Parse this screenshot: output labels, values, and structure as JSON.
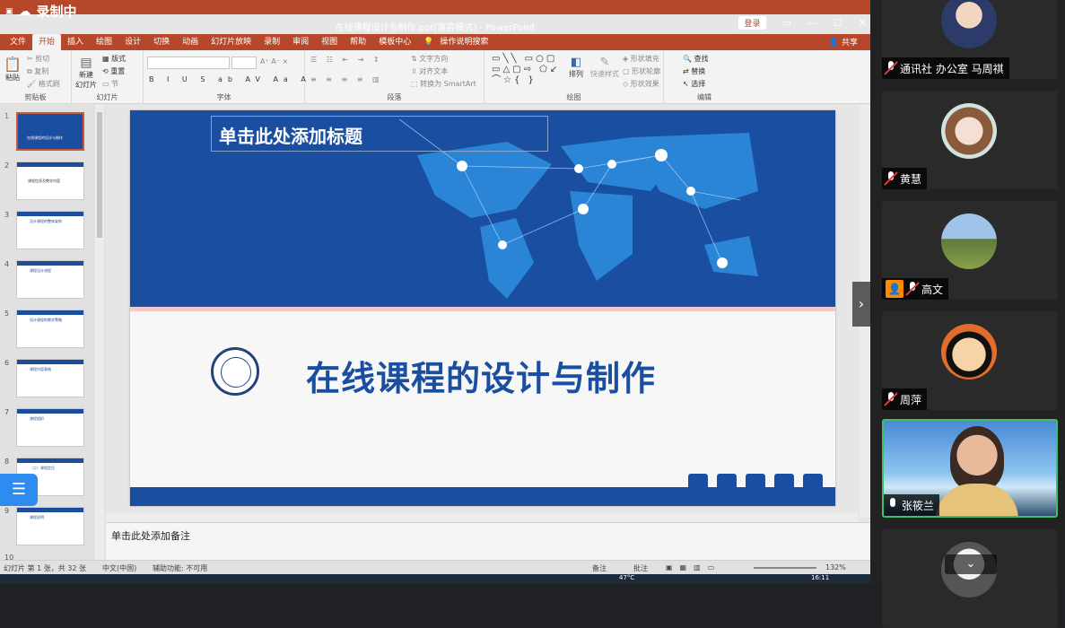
{
  "recording": {
    "label": "录制中"
  },
  "window": {
    "title": "在线课程设计与制作.ppt[兼容模式] - PowerPoint",
    "login_label": "登录",
    "share_label": "共享"
  },
  "tabs": [
    "文件",
    "开始",
    "插入",
    "绘图",
    "设计",
    "切换",
    "动画",
    "幻灯片放映",
    "录制",
    "审阅",
    "视图",
    "帮助",
    "模板中心",
    "操作说明搜索"
  ],
  "ribbon": {
    "clipboard": {
      "paste": "粘贴",
      "cut": "剪切",
      "copy": "复制",
      "format_painter": "格式刷",
      "group": "剪贴板"
    },
    "slides": {
      "new_slide": "新建\n幻灯片",
      "layout": "版式",
      "reset": "重置",
      "section": "节",
      "group": "幻灯片"
    },
    "font": {
      "group": "字体"
    },
    "paragraph": {
      "text_direction": "文字方向",
      "align_text": "对齐文本",
      "smartart": "转换为 SmartArt",
      "group": "段落"
    },
    "drawing": {
      "arrange": "排列",
      "quick_styles": "快速样式",
      "fill": "形状填充",
      "outline": "形状轮廓",
      "effects": "形状效果",
      "group": "绘图"
    },
    "editing": {
      "find": "查找",
      "replace": "替换",
      "select": "选择",
      "group": "编辑"
    }
  },
  "thumbnails": [
    {
      "num": "1",
      "text": "在线课程的设计与制作"
    },
    {
      "num": "2",
      "text": "课程信息及教学内容"
    },
    {
      "num": "3",
      "text": "设计课程的整体架构"
    },
    {
      "num": "4",
      "text": "课程设计流程"
    },
    {
      "num": "5",
      "text": "设计课程的教学策略"
    },
    {
      "num": "6",
      "text": "课程内容表格"
    },
    {
      "num": "7",
      "text": "课程组织"
    },
    {
      "num": "8",
      "text": "（二）课程定位"
    },
    {
      "num": "9",
      "text": "课程说明"
    },
    {
      "num": "10",
      "text": ""
    }
  ],
  "slide": {
    "title_placeholder": "单击此处添加标题",
    "main_title": "在线课程的设计与制作"
  },
  "notes": {
    "placeholder": "单击此处添加备注"
  },
  "status": {
    "slide_info": "幻灯片 第 1 张，共 32 张",
    "language": "中文(中国)",
    "accessibility": "辅助功能: 不可用",
    "notes_btn": "备注",
    "comments_btn": "批注",
    "zoom": "132%",
    "temp": "47°C",
    "clock": "16:11"
  },
  "participants": [
    {
      "name": "通讯社 办公室 马周祺",
      "muted": true
    },
    {
      "name": "黄慧",
      "muted": true
    },
    {
      "name": "高文",
      "muted": true
    },
    {
      "name": "周萍",
      "muted": true
    },
    {
      "name": "张筱兰",
      "muted": false
    },
    {
      "name": "",
      "muted": true
    }
  ],
  "colors": {
    "ppt_accent": "#b7472a",
    "slide_blue": "#1a4ea0",
    "active_speaker": "#3cc16c"
  }
}
